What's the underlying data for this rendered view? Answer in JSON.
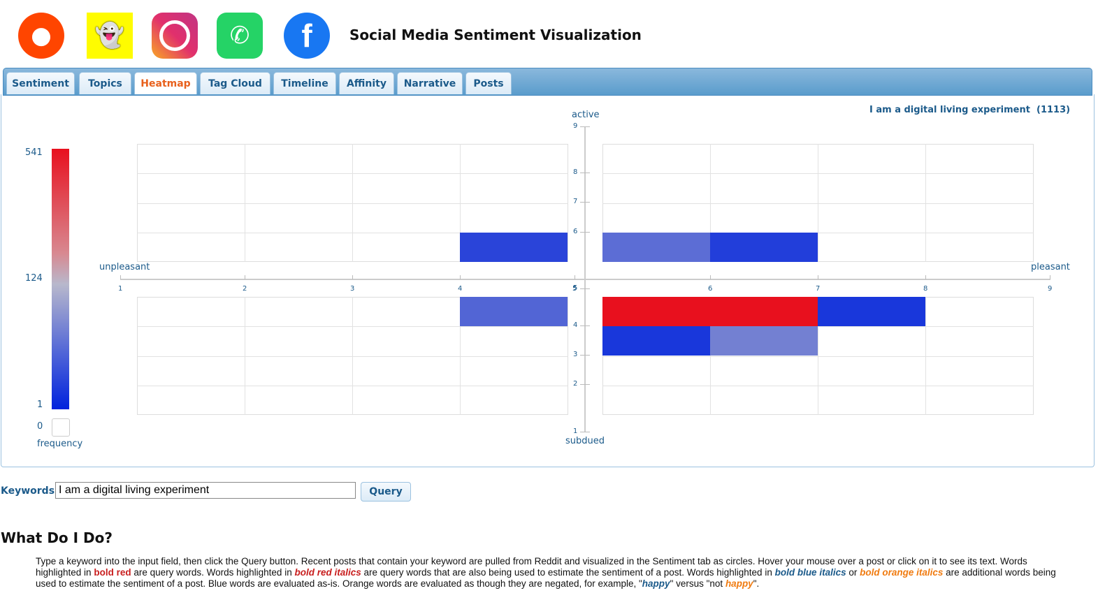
{
  "header": {
    "title": "Social Media Sentiment Visualization",
    "logos": [
      {
        "name": "reddit-logo",
        "color": "#ff4500"
      },
      {
        "name": "snapchat-logo",
        "color": "#fffc00"
      },
      {
        "name": "instagram-logo",
        "color": "#e1306c"
      },
      {
        "name": "whatsapp-logo",
        "color": "#25d366"
      },
      {
        "name": "facebook-logo",
        "color": "#1877f2"
      }
    ]
  },
  "tabs": [
    {
      "label": "Sentiment"
    },
    {
      "label": "Topics"
    },
    {
      "label": "Heatmap",
      "active": true
    },
    {
      "label": "Tag Cloud"
    },
    {
      "label": "Timeline"
    },
    {
      "label": "Affinity"
    },
    {
      "label": "Narrative"
    },
    {
      "label": "Posts"
    }
  ],
  "heatmap": {
    "query_title": "I am a digital living experiment  (1113)",
    "y_top_label": "active",
    "y_bottom_label": "subdued",
    "x_left_label": "unpleasant",
    "x_right_label": "pleasant",
    "legend": {
      "max": "541",
      "mid": "124",
      "min": "1",
      "zero": "0",
      "label": "frequency",
      "colors": {
        "high": "#e8101e",
        "mid": "#b8b8cc",
        "low": "#0022dd"
      }
    }
  },
  "chart_data": {
    "type": "heatmap",
    "xlim": [
      1,
      9
    ],
    "ylim": [
      1,
      9
    ],
    "x_ticks": [
      "1",
      "2",
      "3",
      "4",
      "5",
      "6",
      "7",
      "8",
      "9"
    ],
    "y_ticks": [
      "1",
      "2",
      "3",
      "4",
      "5",
      "6",
      "7",
      "8",
      "9"
    ],
    "cells": [
      {
        "x": 4,
        "y": 5,
        "freq": 10
      },
      {
        "x": 5,
        "y": 5,
        "freq": 30
      },
      {
        "x": 6,
        "y": 5,
        "freq": 8
      },
      {
        "x": 4,
        "y": 4,
        "freq": 25
      },
      {
        "x": 5,
        "y": 4,
        "freq": 520
      },
      {
        "x": 6,
        "y": 4,
        "freq": 460
      },
      {
        "x": 7,
        "y": 4,
        "freq": 6
      },
      {
        "x": 5,
        "y": 3,
        "freq": 6
      },
      {
        "x": 6,
        "y": 3,
        "freq": 45
      }
    ]
  },
  "query": {
    "label": "Keywords:",
    "value": "I am a digital living experiment",
    "button": "Query"
  },
  "help": {
    "heading": "What Do I Do?",
    "t1": "Type a keyword into the input field, then click the Query button. Recent posts that contain your keyword are pulled from Reddit and visualized in the Sentiment tab as circles. Hover your mouse over a post or click on it to see its text. Words highlighted in ",
    "br": "bold red",
    "t2": " are query words. Words highlighted in ",
    "bri": "bold red italics",
    "t3": " are query words that are also being used to estimate the sentiment of a post. Words highlighted in ",
    "bbi": "bold blue italics",
    "t4": " or ",
    "boi": "bold orange italics",
    "t5": " are additional words being used to estimate the sentiment of a post. Blue words are evaluated as-is. Orange words are evaluated as though they are negated, for example, \"",
    "happy1": "happy",
    "t6": "\" versus \"not ",
    "happy2": "happy",
    "t7": "\"."
  }
}
